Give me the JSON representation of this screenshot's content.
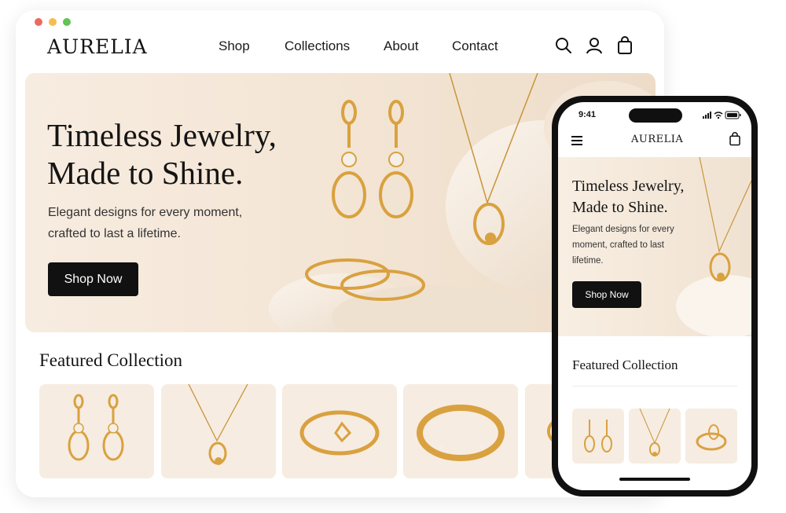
{
  "desktop": {
    "logo": "AURELIA",
    "nav": [
      "Shop",
      "Collections",
      "About",
      "Contact"
    ],
    "hero": {
      "title_line1": "Timeless Jewelry,",
      "title_line2": "Made to Shine.",
      "subtitle_line1": "Elegant designs for every moment,",
      "subtitle_line2": "crafted to last a lifetime.",
      "cta": "Shop Now"
    },
    "featured_title": "Featured Collection",
    "products": [
      "pearl-drop-earrings",
      "gold-pendant-necklace",
      "gold-ring",
      "gold-bangle",
      "partial-product"
    ]
  },
  "phone": {
    "time": "9:41",
    "logo": "AURELIA",
    "hero": {
      "title_line1": "Timeless Jewelry,",
      "title_line2": "Made to Shine.",
      "subtitle_line1": "Elegant designs for every",
      "subtitle_line2": "moment, crafted to last",
      "subtitle_line3": "lifetime.",
      "cta": "Shop Now"
    },
    "featured_title": "Featured Collection"
  },
  "colors": {
    "accent": "#111111",
    "gold": "#d9a13f",
    "hero_bg": "#f4e6d6",
    "card_bg": "#f6ece1"
  },
  "icons": [
    "search-icon",
    "user-icon",
    "bag-icon",
    "menu-icon",
    "signal-icon",
    "wifi-icon",
    "battery-icon"
  ]
}
